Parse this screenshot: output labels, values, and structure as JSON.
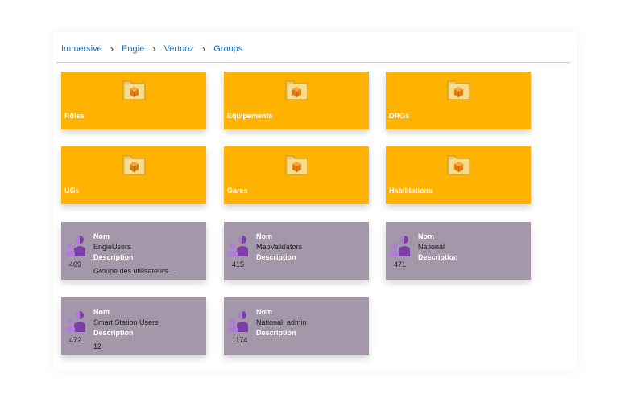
{
  "breadcrumb": [
    "Immersive",
    "Engie",
    "Vertuoz",
    "Groups"
  ],
  "labels": {
    "nom": "Nom",
    "description": "Description"
  },
  "folders": [
    {
      "name": "Rôles"
    },
    {
      "name": "Equipements"
    },
    {
      "name": "DRGs"
    },
    {
      "name": "UGs"
    },
    {
      "name": "Gares"
    },
    {
      "name": "Habilitations"
    }
  ],
  "groups": [
    {
      "name": "EngieUsers",
      "count": "409",
      "description": "Groupe des utilisateurs ..."
    },
    {
      "name": "MapValidators",
      "count": "415",
      "description": ""
    },
    {
      "name": "National",
      "count": "471",
      "description": ""
    },
    {
      "name": "Smart Station Users",
      "count": "472",
      "description": "12"
    },
    {
      "name": "National_admin",
      "count": "1174",
      "description": ""
    }
  ],
  "colors": {
    "folder": "#ffb300",
    "group": "#a397a9",
    "link": "#1a6bb5"
  },
  "icons": {
    "folder": "folder-package-icon",
    "group": "users-group-icon"
  }
}
